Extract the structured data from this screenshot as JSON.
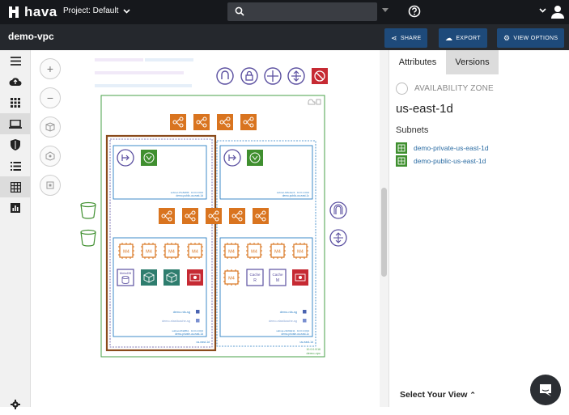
{
  "topbar": {
    "logo_text": "hava",
    "project_label": "Project: Default",
    "search_placeholder": ""
  },
  "subbar": {
    "title": "demo-vpc",
    "share_label": "SHARE",
    "export_label": "EXPORT",
    "view_options_label": "VIEW OPTIONS"
  },
  "sidebar": {
    "items": [
      "menu-icon",
      "cloud-upload-icon",
      "grid-icon",
      "laptop-icon",
      "shield-icon",
      "list-icon",
      "table-icon",
      "chart-icon"
    ]
  },
  "diagram": {
    "vpc_labels": [
      "10.0.0.0/16",
      "demo-vpc"
    ],
    "az_labels": [
      "us-east-1d"
    ],
    "subnet_top_left": [
      "subnet-07e5d80f · 10.0.0.0/24",
      "demo-public-us-east-1d"
    ],
    "subnet_top_right": [
      "subnet-b2fe4ec3 · 10.0.1.0/24",
      "demo-public-us-east-1c"
    ],
    "subnet_bottom_left": [
      "subnet-0f4d8b1 · 10.0.2.0/24",
      "demo-private-us-east-1d"
    ],
    "subnet_bottom_right": [
      "subnet-c1b9bd11 · 10.0.3.0/24",
      "demo-private-us-east-1c"
    ],
    "instance_label": "M4",
    "metadb_label": "MetaDB",
    "cache_labels": [
      "Cache R",
      "Cache M"
    ],
    "security_groups": [
      "demo-rds-sg",
      "demo-elasticache-sg"
    ]
  },
  "panel": {
    "tab_attributes": "Attributes",
    "tab_versions": "Versions",
    "az_label": "AVAILABILITY ZONE",
    "az_name": "us-east-1d",
    "subnets_heading": "Subnets",
    "subnets": [
      "demo-private-us-east-1d",
      "demo-public-us-east-1d"
    ],
    "select_view": "Select Your View"
  },
  "colors": {
    "topbar": "#16181c",
    "subbar": "#25282d",
    "button": "#1e4a7a",
    "vpc_border": "#4aa04a",
    "subnet_border": "#2b7fc4",
    "az_border": "#8a4b1c",
    "orange": "#d9741f",
    "green": "#3f8f2f",
    "purple": "#5a4fa0",
    "red": "#c62a33",
    "teal": "#2e7d6e",
    "link": "#2b6ca3"
  }
}
